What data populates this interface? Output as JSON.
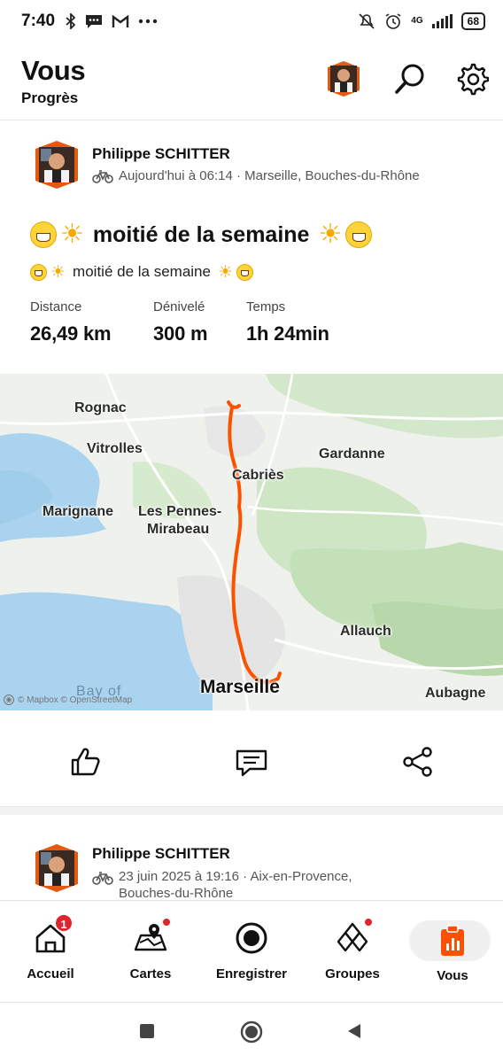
{
  "status_bar": {
    "time": "7:40",
    "network": "4G",
    "battery": "68"
  },
  "header": {
    "title": "Vous",
    "subtitle": "Progrès"
  },
  "activity": {
    "athlete_name": "Philippe SCHITTER",
    "meta": "Aujourd'hui à 06:14 · Marseille, Bouches-du-Rhône",
    "title": "moitié de la semaine",
    "description": "moitié de la semaine",
    "stats": [
      {
        "label": "Distance",
        "value": "26,49 km"
      },
      {
        "label": "Dénivelé",
        "value": "300 m"
      },
      {
        "label": "Temps",
        "value": "1h 24min"
      }
    ],
    "map": {
      "labels": {
        "rognac": "Rognac",
        "vitrolles": "Vitrolles",
        "gardanne": "Gardanne",
        "cabries": "Cabriès",
        "marignane": "Marignane",
        "les_pennes_1": "Les Pennes-",
        "les_pennes_2": "Mirabeau",
        "allauch": "Allauch",
        "marseille": "Marseille",
        "aubagne": "Aubagne",
        "bay": "Bay of"
      },
      "attribution": "© Mapbox © OpenStreetMap",
      "route_color": "#fc5200"
    }
  },
  "next_activity": {
    "athlete_name": "Philippe SCHITTER",
    "meta_line1": "23 juin 2025 à 19:16 · Aix-en-Provence,",
    "meta_line2": "Bouches-du-Rhône"
  },
  "bottom_nav": {
    "items": [
      {
        "label": "Accueil",
        "badge": "1"
      },
      {
        "label": "Cartes"
      },
      {
        "label": "Enregistrer"
      },
      {
        "label": "Groupes"
      },
      {
        "label": "Vous"
      }
    ]
  },
  "colors": {
    "accent": "#fc5200",
    "badge": "#e0242b"
  }
}
